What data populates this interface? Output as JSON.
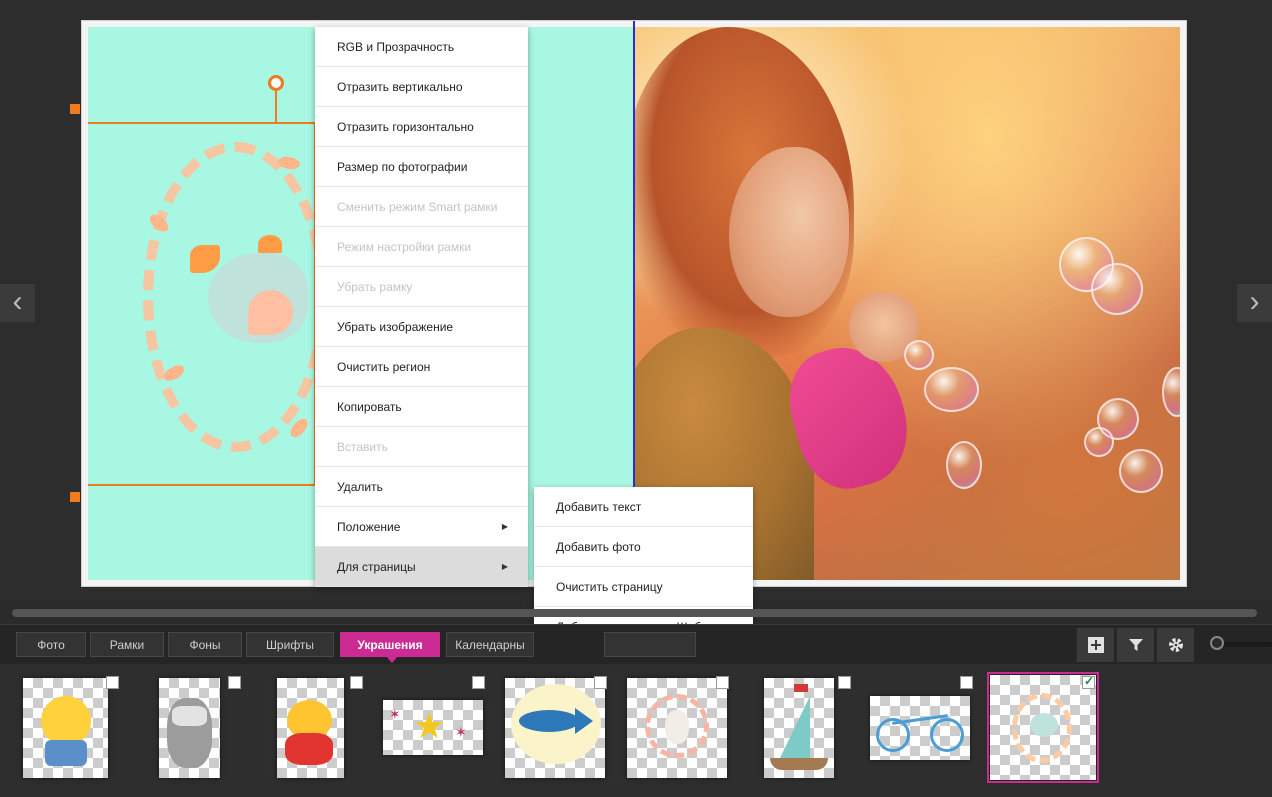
{
  "context_menu": {
    "items": [
      {
        "label": "RGB и Прозрачность",
        "enabled": true
      },
      {
        "label": "Отразить вертикально",
        "enabled": true
      },
      {
        "label": "Отразить горизонтально",
        "enabled": true
      },
      {
        "label": "Размер по фотографии",
        "enabled": true
      },
      {
        "label": "Сменить режим Smart рамки",
        "enabled": false
      },
      {
        "label": "Режим настройки рамки",
        "enabled": false
      },
      {
        "label": "Убрать рамку",
        "enabled": false
      },
      {
        "label": "Убрать изображение",
        "enabled": true
      },
      {
        "label": "Очистить регион",
        "enabled": true
      },
      {
        "label": "Копировать",
        "enabled": true
      },
      {
        "label": "Вставить",
        "enabled": false
      },
      {
        "label": "Удалить",
        "enabled": true
      },
      {
        "label": "Положение",
        "enabled": true,
        "submenu": true
      },
      {
        "label": "Для страницы",
        "enabled": true,
        "submenu": true,
        "highlighted": true
      }
    ],
    "submenu_arrow": "▶"
  },
  "submenu": {
    "items": [
      {
        "label": "Добавить текст"
      },
      {
        "label": "Добавить фото"
      },
      {
        "label": "Очистить страницу"
      },
      {
        "label": "Добавить страницу в Шаблоны"
      }
    ]
  },
  "nav": {
    "prev_icon": "‹",
    "next_icon": "›"
  },
  "tabs": [
    {
      "label": "Фото"
    },
    {
      "label": "Рамки"
    },
    {
      "label": "Фоны"
    },
    {
      "label": "Шрифты"
    },
    {
      "label": "Украшения",
      "active": true
    },
    {
      "label": "Календарны"
    }
  ],
  "toolbar": {
    "add_icon": "plus-square-icon",
    "filter_icon": "filter-icon",
    "settings_icon": "gear-icon"
  },
  "colors": {
    "accent": "#cc2b93",
    "selection": "#f07a1e",
    "left_page_bg": "#a8f7e3"
  },
  "thumbnails": [
    {
      "name": "chick-sticker",
      "checked": false
    },
    {
      "name": "owl-sticker",
      "checked": false
    },
    {
      "name": "rooster-sticker",
      "checked": false
    },
    {
      "name": "stars-sticker",
      "checked": false
    },
    {
      "name": "fish-sticker",
      "checked": false
    },
    {
      "name": "bunny-wreath-sticker",
      "checked": false
    },
    {
      "name": "sailboat-sticker",
      "checked": false
    },
    {
      "name": "bicycle-sticker",
      "checked": false
    },
    {
      "name": "bird-wreath-sticker",
      "checked": true
    }
  ]
}
